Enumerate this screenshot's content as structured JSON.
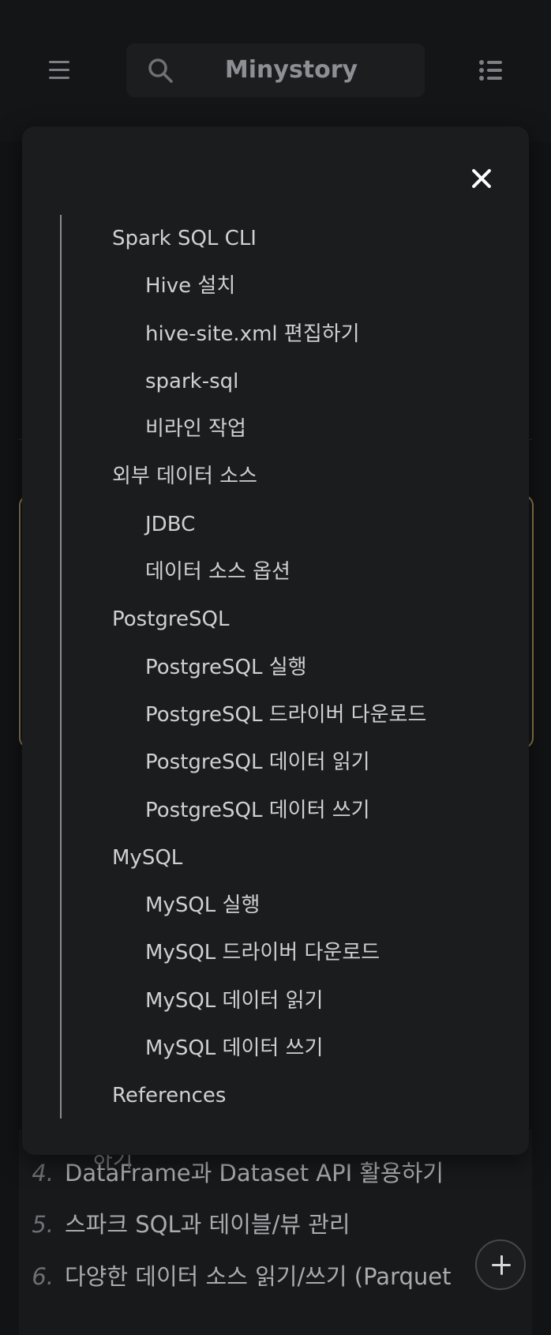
{
  "header": {
    "site_title": "Minystory",
    "menu_icon": "hamburger-menu-icon",
    "search_icon": "search-icon",
    "toc_icon": "list-icon"
  },
  "toc": {
    "close_icon": "close-icon",
    "items": [
      {
        "label": "Spark SQL CLI",
        "level": 1
      },
      {
        "label": "Hive 설치",
        "level": 2
      },
      {
        "label": "hive-site.xml 편집하기",
        "level": 2
      },
      {
        "label": "spark-sql",
        "level": 2
      },
      {
        "label": "비라인 작업",
        "level": 2
      },
      {
        "label": "외부 데이터 소스",
        "level": 1
      },
      {
        "label": "JDBC",
        "level": 2
      },
      {
        "label": "데이터 소스 옵션",
        "level": 2
      },
      {
        "label": "PostgreSQL",
        "level": 1
      },
      {
        "label": "PostgreSQL 실행",
        "level": 2
      },
      {
        "label": "PostgreSQL 드라이버 다운로드",
        "level": 2
      },
      {
        "label": "PostgreSQL 데이터 읽기",
        "level": 2
      },
      {
        "label": "PostgreSQL 데이터 쓰기",
        "level": 2
      },
      {
        "label": "MySQL",
        "level": 1
      },
      {
        "label": "MySQL 실행",
        "level": 2
      },
      {
        "label": "MySQL 드라이버 다운로드",
        "level": 2
      },
      {
        "label": "MySQL 데이터 읽기",
        "level": 2
      },
      {
        "label": "MySQL 데이터 쓰기",
        "level": 2
      },
      {
        "label": "References",
        "level": 1
      }
    ]
  },
  "background_list": {
    "fragment": "하기",
    "items": [
      {
        "num": "4.",
        "text": "DataFrame과 Dataset API 활용하기"
      },
      {
        "num": "5.",
        "text": "스파크 SQL과 테이블/뷰 관리"
      },
      {
        "num": "6.",
        "text": "다양한 데이터 소스 읽기/쓰기 (Parquet"
      }
    ]
  },
  "fab": {
    "icon": "plus-icon"
  },
  "colors": {
    "background": "#121314",
    "panel": "#1b1c1e",
    "card_border": "#8d7a52",
    "text": "#cfd0d3"
  }
}
